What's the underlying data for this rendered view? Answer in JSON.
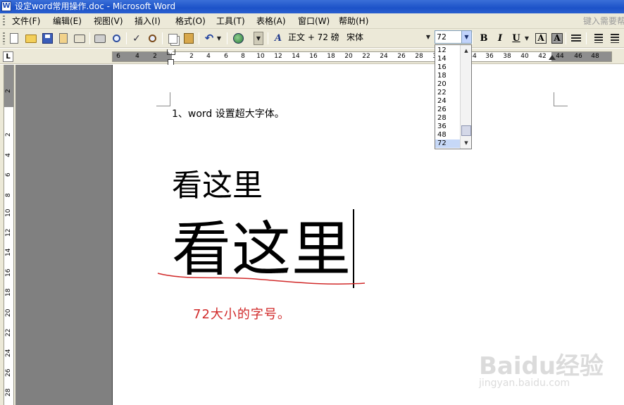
{
  "titlebar": {
    "title": "设定word常用操作.doc - Microsoft Word",
    "app_icon": "W"
  },
  "menubar": {
    "items": [
      {
        "label": "文件(F)"
      },
      {
        "label": "编辑(E)"
      },
      {
        "label": "视图(V)"
      },
      {
        "label": "插入(I)"
      },
      {
        "label": "格式(O)"
      },
      {
        "label": "工具(T)"
      },
      {
        "label": "表格(A)"
      },
      {
        "label": "窗口(W)"
      },
      {
        "label": "帮助(H)"
      }
    ],
    "help_search_placeholder": "键入需要帮"
  },
  "toolbar": {
    "style_label": "正文 + 72 磅",
    "font_name": "宋体",
    "font_size": "72",
    "bold_label": "B",
    "italic_label": "I",
    "underline_label": "U",
    "font_color_label": "A",
    "char_shading_label": "A",
    "icons": [
      "new-document-icon",
      "open-folder-icon",
      "save-icon",
      "permission-icon",
      "email-icon",
      "print-icon",
      "print-preview-icon",
      "spelling-icon",
      "research-icon",
      "copy-icon",
      "paste-icon",
      "undo-icon",
      "hyperlink-icon",
      "styles-formatting-icon"
    ]
  },
  "ruler": {
    "tab_selector": "L",
    "horizontal_numbers": [
      "6",
      "4",
      "2",
      "2",
      "4",
      "6",
      "8",
      "10",
      "12",
      "14",
      "16",
      "18",
      "20",
      "22",
      "24",
      "26",
      "28",
      "30",
      "32",
      "34",
      "36",
      "38",
      "40",
      "42",
      "44",
      "46",
      "48"
    ],
    "vertical_numbers": [
      "2",
      "2",
      "4",
      "6",
      "8",
      "10",
      "12",
      "14",
      "16",
      "18",
      "20",
      "22",
      "24",
      "26",
      "28"
    ]
  },
  "document": {
    "line1": "1、word 设置超大字体。",
    "line2": "看这里",
    "line3": "看这里",
    "annotation": "72大小的字号。",
    "annotation_color": "#d12a2a"
  },
  "font_size_dropdown": {
    "options": [
      "12",
      "14",
      "16",
      "18",
      "20",
      "22",
      "24",
      "26",
      "28",
      "36",
      "48",
      "72"
    ],
    "selected": "72"
  },
  "watermark": {
    "logo": "Baidu经验",
    "url": "jingyan.baidu.com"
  }
}
